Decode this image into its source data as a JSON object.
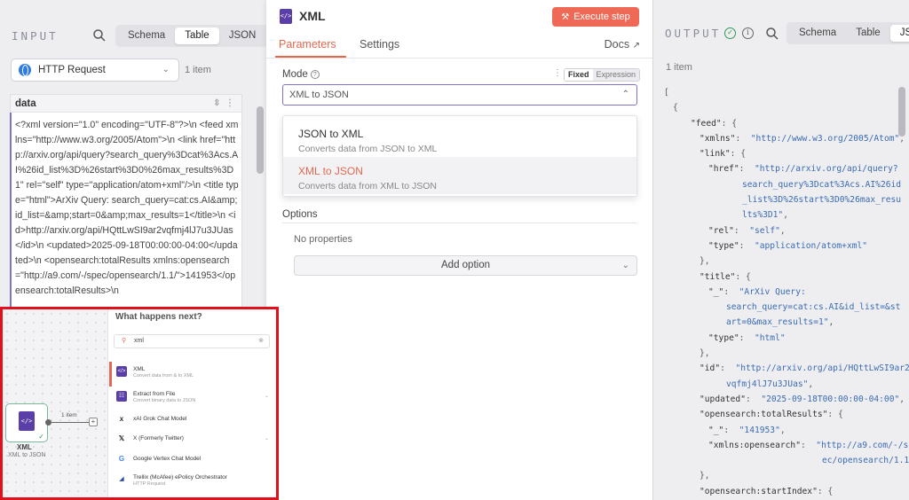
{
  "input_panel": {
    "title": "INPUT",
    "view_tabs": [
      "Schema",
      "Table",
      "JSON"
    ],
    "active_view": "Table",
    "node_select": "HTTP Request",
    "item_count": "1 item",
    "column_header": "data",
    "data_value": "<?xml version=\"1.0\" encoding=\"UTF-8\"?>\\n <feed xmlns=\"http://www.w3.org/2005/Atom\">\\n   <link href=\"http://arxiv.org/api/query?search_query%3Dcat%3Acs.AI%26id_list%3D%26start%3D0%26max_results%3D1\" rel=\"self\" type=\"application/atom+xml\"/>\\n   <title type=\"html\">ArXiv Query: search_query=cat:cs.AI&amp;id_list=&amp;start=0&amp;max_results=1</title>\\n   <id>http://arxiv.org/api/HQttLwSI9ar2vqfmj4lJ7u3JUas</id>\\n   <updated>2025-09-18T00:00:00-04:00</updated>\\n   <opensearch:totalResults xmlns:opensearch=\"http://a9.com/-/spec/opensearch/1.1/\">141953</opensearch:totalResults>\\n"
  },
  "param_panel": {
    "node_title": "XML",
    "execute_label": "Execute step",
    "tabs": [
      "Parameters",
      "Settings"
    ],
    "active_tab": "Parameters",
    "docs_label": "Docs",
    "mode_label": "Mode",
    "fixed_label": "Fixed",
    "expression_label": "Expression",
    "mode_value": "XML to JSON",
    "mode_options": [
      {
        "title": "JSON to XML",
        "description": "Converts data from JSON to XML"
      },
      {
        "title": "XML to JSON",
        "description": "Converts data from XML to JSON"
      }
    ],
    "selected_option": "XML to JSON",
    "options_label": "Options",
    "no_properties": "No properties",
    "add_option_label": "Add option"
  },
  "output_panel": {
    "title": "OUTPUT",
    "view_tabs": [
      "Schema",
      "Table",
      "JSO"
    ],
    "active_view": "JSON",
    "item_count": "1 item",
    "status_color": "#2e9a5a"
  },
  "inset": {
    "panel_title": "What happens next?",
    "search_value": "xml",
    "node_name": "XML",
    "node_subtitle": "XML to JSON",
    "connection_label": "1 item",
    "items": [
      {
        "name": "XML",
        "desc": "Convert data from & to XML",
        "icon": "xml-icon"
      },
      {
        "name": "Extract from File",
        "desc": "Convert binary data to JSON",
        "icon": "extract-file-icon"
      },
      {
        "name": "xAI Grok Chat Model",
        "desc": "",
        "icon": "xai-icon"
      },
      {
        "name": "X (Formerly Twitter)",
        "desc": "",
        "icon": "x-icon"
      },
      {
        "name": "Google Vertex Chat Model",
        "desc": "",
        "icon": "google-icon"
      },
      {
        "name": "Trellix (McAfee) ePolicy Orchestrator",
        "desc": "HTTP Request",
        "icon": "trellix-icon"
      }
    ]
  },
  "colors": {
    "accent": "#e4684f",
    "execute_button": "#ee6a57",
    "json_string": "#3a6bb3",
    "highlight_border": "#e0101c",
    "node_purple": "#5b3fa8"
  }
}
